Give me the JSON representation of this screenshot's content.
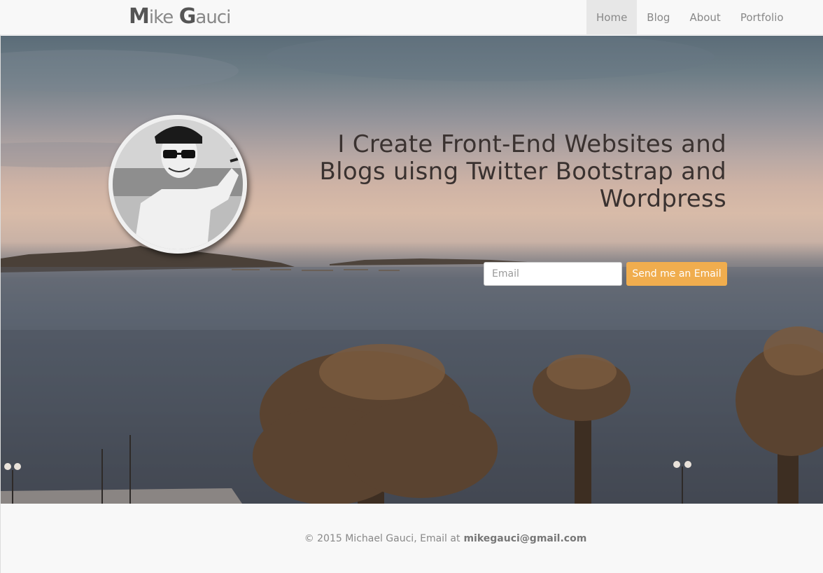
{
  "brand": {
    "first_initial": "M",
    "first_rest": "ike",
    "last_initial": "G",
    "last_rest": "auci"
  },
  "nav": {
    "items": [
      {
        "label": "Home",
        "active": true
      },
      {
        "label": "Blog",
        "active": false
      },
      {
        "label": "About",
        "active": false
      },
      {
        "label": "Portfolio",
        "active": false
      }
    ]
  },
  "hero": {
    "headline_line1": "I Create Front-End Websites and",
    "headline_line2": "Blogs uisng Twitter Bootstrap and",
    "headline_line3": "Wordpress",
    "email_placeholder": "Email",
    "email_value": "",
    "send_label": "Send me an Email"
  },
  "footer": {
    "text": "© 2015 Michael Gauci, Email at",
    "email": "mikegauci@gmail.com"
  },
  "colors": {
    "accent": "#f0ad4e",
    "navbar_bg": "#f8f8f8",
    "nav_active_bg": "#e7e7e7",
    "headline": "#3a3230"
  }
}
